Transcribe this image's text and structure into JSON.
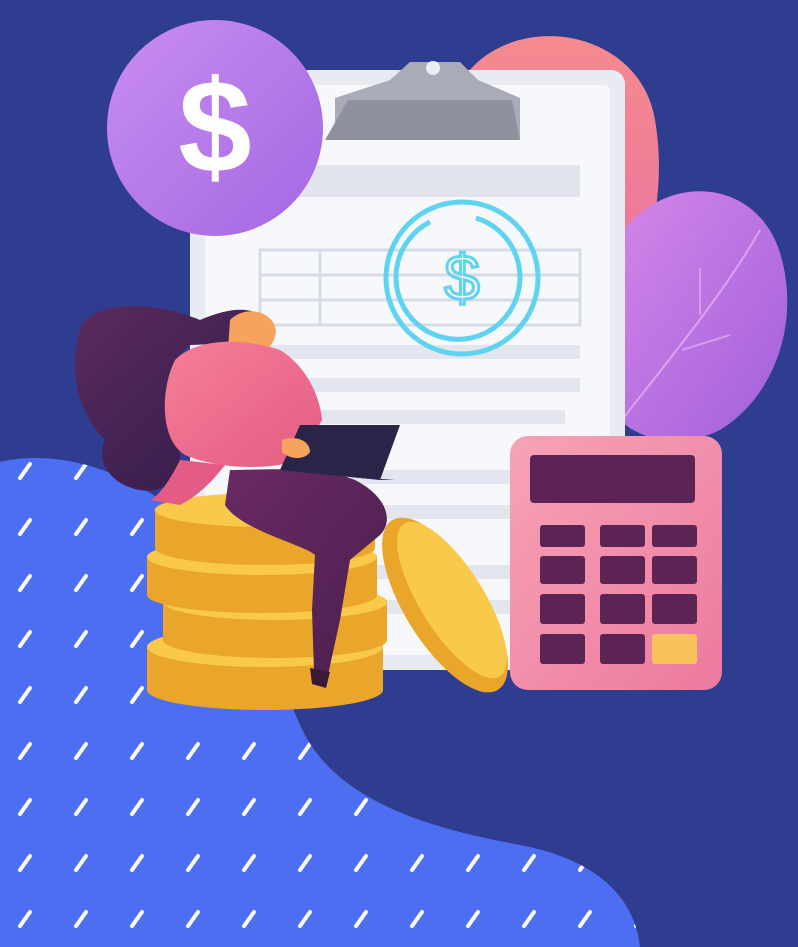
{
  "illustration": {
    "dollar_badge_glyph": "$",
    "document_dollar_glyph": "$",
    "icons": [
      "dollar-badge-icon",
      "clipboard-icon",
      "dollar-ring-icon",
      "calculator-icon",
      "coin-stack-icon",
      "laptop-icon"
    ],
    "colors": {
      "background": "#2e3d8f",
      "blob": "#4e6ef2",
      "badge": "#b476e6",
      "paper": "#f2f4f8",
      "document_ring": "#5fd3ef",
      "calculator": "#f08aa8",
      "coin": "#f5be3a",
      "woman_top": "#f06d8d",
      "hair": "#4a2150",
      "leaf_pink": "#f07f8c",
      "leaf_purple": "#c37ae6"
    }
  }
}
